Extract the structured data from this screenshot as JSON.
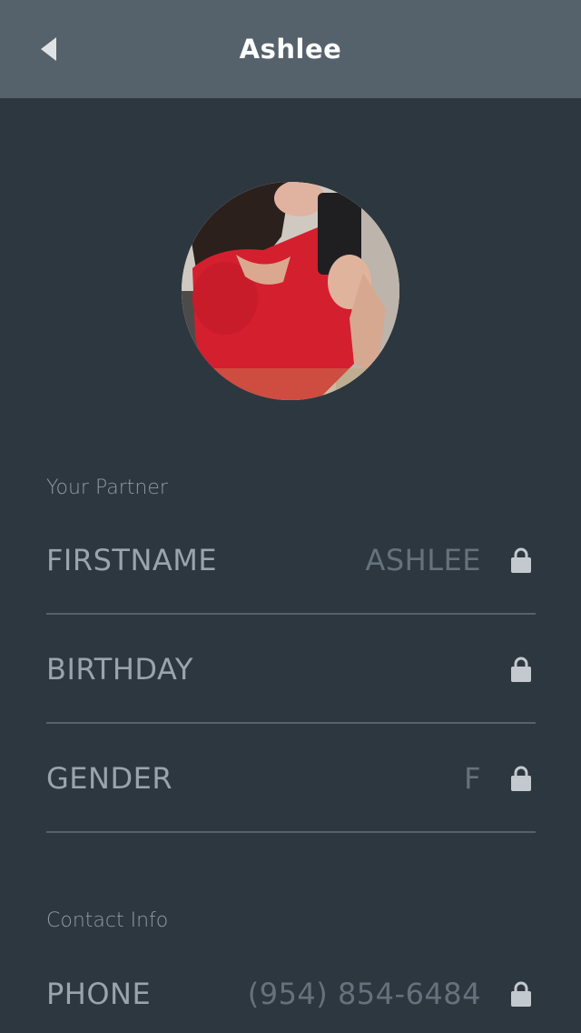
{
  "header": {
    "title": "Ashlee",
    "back_icon": "back-arrow-icon"
  },
  "profile": {
    "avatar": "profile-photo"
  },
  "partner_section": {
    "title": "Your Partner",
    "fields": [
      {
        "label": "FIRSTNAME",
        "value": "ASHLEE",
        "locked": true
      },
      {
        "label": "BIRTHDAY",
        "value": "",
        "locked": true
      },
      {
        "label": "GENDER",
        "value": "F",
        "locked": true
      }
    ]
  },
  "contact_section": {
    "title": "Contact Info",
    "fields": [
      {
        "label": "PHONE",
        "value": "(954) 854-6484",
        "locked": true
      }
    ]
  },
  "colors": {
    "background": "#2d3740",
    "navbar": "#56626b",
    "label": "#9aa4ac",
    "value": "#66727b",
    "lock": "#c3c9ce",
    "divider": "#56616a"
  }
}
